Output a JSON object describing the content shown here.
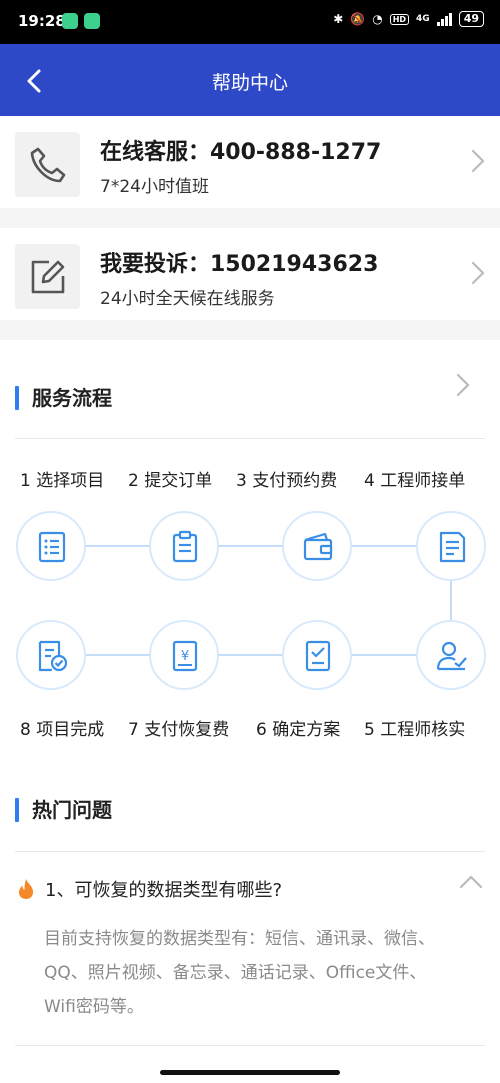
{
  "status_bar": {
    "time": "19:28",
    "network": "4G",
    "battery": "49"
  },
  "header": {
    "title": "帮助中心"
  },
  "contacts": [
    {
      "title": "在线客服：400-888-1277",
      "subtitle": "7*24小时值班",
      "icon": "phone-icon"
    },
    {
      "title": "我要投诉：15021943623",
      "subtitle": "24小时全天候在线服务",
      "icon": "edit-icon"
    }
  ],
  "service_flow": {
    "title": "服务流程",
    "steps_top": [
      "1 选择项目",
      "2 提交订单",
      "3 支付预约费",
      "4 工程师接单"
    ],
    "steps_bottom": [
      "8 项目完成",
      "7 支付恢复费",
      "6 确定方案",
      "5 工程师核实"
    ],
    "icons_top": [
      "list-icon",
      "clipboard-icon",
      "wallet-icon",
      "document-icon"
    ],
    "icons_bottom": [
      "doc-check-icon",
      "yuan-receipt-icon",
      "checklist-icon",
      "engineer-check-icon"
    ]
  },
  "hot_questions": {
    "title": "热门问题",
    "items": [
      {
        "question": "1、可恢复的数据类型有哪些?",
        "answer": "目前支持恢复的数据类型有：短信、通讯录、微信、QQ、照片视频、备忘录、通话记录、Office文件、Wifi密码等。"
      }
    ]
  },
  "colors": {
    "header_bg": "#2d49c7",
    "accent": "#2d7ff0",
    "icon_blue": "#3a8ee6"
  }
}
